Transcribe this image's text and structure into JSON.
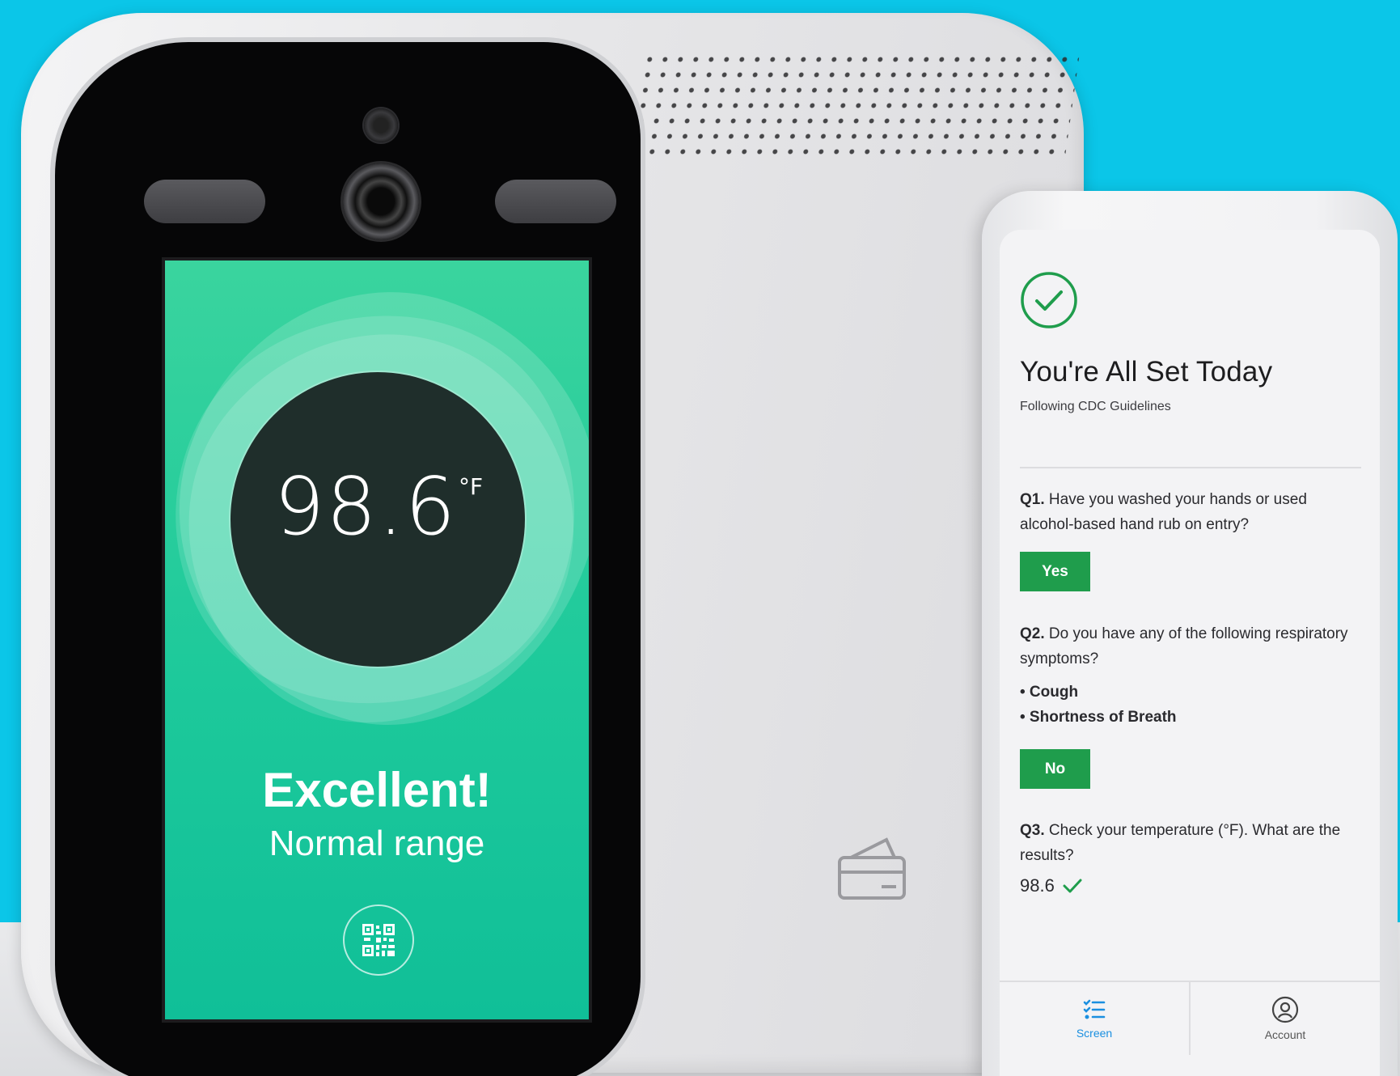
{
  "kiosk": {
    "temperature": "98.6",
    "unit": "°F",
    "status_title": "Excellent!",
    "status_subtitle": "Normal range",
    "qr_icon": "qr-code-icon",
    "card_icon": "card-reader-icon"
  },
  "app": {
    "check_icon": "check-circle-icon",
    "title": "You're All Set Today",
    "subtitle": "Following CDC Guidelines",
    "questions": [
      {
        "number": "Q1.",
        "text": "Have you washed your hands or used alcohol-based hand rub on entry?",
        "answer": "Yes"
      },
      {
        "number": "Q2.",
        "text": "Do you have any of the following respiratory symptoms?",
        "symptoms": [
          "• Cough",
          "• Shortness of Breath"
        ],
        "answer": "No"
      },
      {
        "number": "Q3.",
        "text": "Check your temperature (°F). What are the results?",
        "answer": "98.6"
      }
    ],
    "nav": [
      {
        "label": "Screen",
        "icon": "checklist-icon",
        "active": true
      },
      {
        "label": "Account",
        "icon": "account-icon",
        "active": false
      }
    ]
  },
  "colors": {
    "background": "#0bc6e8",
    "screen_green": "#1dc99b",
    "button_green": "#1f9d4c",
    "nav_active": "#1a8fe0"
  }
}
